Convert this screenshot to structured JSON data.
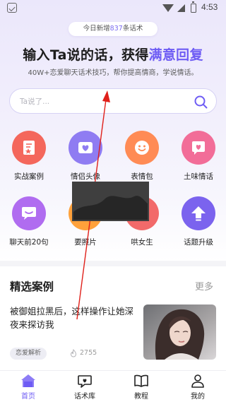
{
  "status_bar": {
    "time": "4:53"
  },
  "header": {
    "new_today_prefix": "今日新增",
    "new_today_count": "837",
    "new_today_suffix": "条话术",
    "title_main": "输入Ta说的话，获得",
    "title_accent": "满意回复",
    "subtitle": "40W+恋爱聊天话术技巧，帮你提高情商，学说情话。"
  },
  "search": {
    "placeholder": "Ta说了..."
  },
  "features": [
    {
      "label": "实战案例",
      "icon": "document-star-icon",
      "color": "#f4675c"
    },
    {
      "label": "情侣头像",
      "icon": "heart-avatar-icon",
      "color": "#8f7cf2"
    },
    {
      "label": "表情包",
      "icon": "smiley-icon",
      "color": "#ff8b55"
    },
    {
      "label": "土味情话",
      "icon": "heart-chat-icon",
      "color": "#f26d98"
    },
    {
      "label": "聊天前20句",
      "icon": "chat-bubble-icon",
      "color": "#b06cf0"
    },
    {
      "label": "要照片",
      "icon": "photo-icon",
      "color": "#ffa13b"
    },
    {
      "label": "哄女生",
      "icon": "coax-icon",
      "color": "#f26a6a"
    },
    {
      "label": "话题升级",
      "icon": "arrow-up-icon",
      "color": "#7b63ee"
    }
  ],
  "featured": {
    "title": "精选案例",
    "more": "更多",
    "case": {
      "title": "被御姐拉黑后，这样操作让她深夜来探访我",
      "tag": "恋爱解析",
      "views": "2755"
    }
  },
  "tabbar": [
    {
      "label": "首页",
      "icon": "home-icon",
      "active": true
    },
    {
      "label": "话术库",
      "icon": "heart-bubble-icon",
      "active": false
    },
    {
      "label": "教程",
      "icon": "book-icon",
      "active": false
    },
    {
      "label": "我的",
      "icon": "person-icon",
      "active": false
    }
  ],
  "colors": {
    "accent": "#6e5cf4",
    "annotation": "#e0201a"
  }
}
